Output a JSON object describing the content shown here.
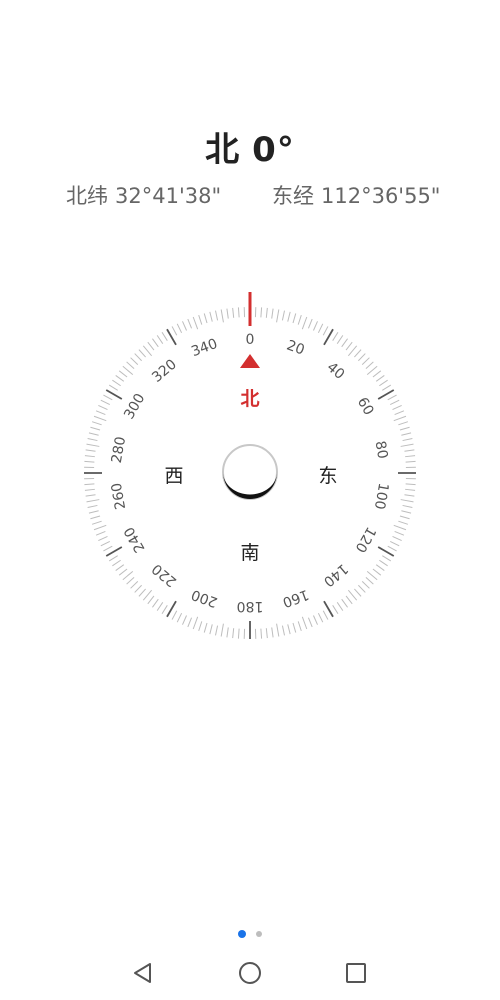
{
  "heading": {
    "direction": "北",
    "degrees": "0°"
  },
  "coordinates": {
    "latitude_label": "北纬",
    "latitude_value": "32°41'38\"",
    "longitude_label": "东经",
    "longitude_value": "112°36'55\""
  },
  "compass": {
    "heading_value": 0,
    "north_label": "北",
    "south_label": "南",
    "east_label": "东",
    "west_label": "西",
    "degree_labels": [
      "0",
      "20",
      "40",
      "60",
      "80",
      "100",
      "120",
      "140",
      "160",
      "180",
      "200",
      "220",
      "240",
      "260",
      "280",
      "300",
      "320",
      "340"
    ],
    "colors": {
      "accent": "#d32f2f",
      "tick": "#bdbdbd",
      "major_tick": "#555555",
      "label": "#555555"
    }
  },
  "pager": {
    "total_pages": 2,
    "active_page": 1,
    "active_color": "#1a73e8",
    "inactive_color": "#bdbdbd"
  },
  "navbar": {
    "icons": [
      "back-triangle-icon",
      "home-circle-icon",
      "recent-square-icon"
    ]
  }
}
